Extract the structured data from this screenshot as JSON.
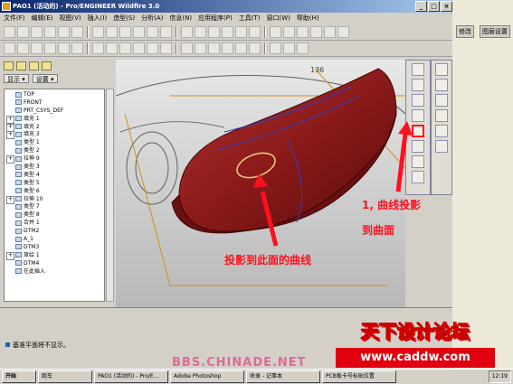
{
  "window": {
    "title": "PAO1 (活动的) - Pro/ENGINEER Wildfire 3.0"
  },
  "menu": [
    "文件(F)",
    "编辑(E)",
    "视图(V)",
    "插入(I)",
    "造型(S)",
    "分析(A)",
    "信息(N)",
    "应用程序(P)",
    "工具(T)",
    "窗口(W)",
    "帮助(H)"
  ],
  "sidepane": {
    "show_label": "显示",
    "settings_label": "设置"
  },
  "model_tree": [
    {
      "label": "TOP",
      "icon": "datum-plane-icon",
      "expand": false
    },
    {
      "label": "FRONT",
      "icon": "datum-plane-icon",
      "expand": false
    },
    {
      "label": "PRT_CSYS_DEF",
      "icon": "csys-icon",
      "expand": false
    },
    {
      "label": "填充 1",
      "icon": "fill-icon",
      "expand": true
    },
    {
      "label": "填充 2",
      "icon": "fill-icon",
      "expand": true
    },
    {
      "label": "填充 3",
      "icon": "fill-icon",
      "expand": true
    },
    {
      "label": "类型 1",
      "icon": "surface-icon",
      "expand": false
    },
    {
      "label": "类型 2",
      "icon": "surface-icon",
      "expand": false
    },
    {
      "label": "拉伸 9",
      "icon": "extrude-icon",
      "expand": true
    },
    {
      "label": "类型 3",
      "icon": "surface-icon",
      "expand": false
    },
    {
      "label": "类型 4",
      "icon": "surface-icon",
      "expand": false
    },
    {
      "label": "类型 5",
      "icon": "surface-icon",
      "expand": false
    },
    {
      "label": "类型 6",
      "icon": "surface-icon",
      "expand": false
    },
    {
      "label": "拉伸 10",
      "icon": "extrude-icon",
      "expand": true
    },
    {
      "label": "类型 7",
      "icon": "surface-icon",
      "expand": false
    },
    {
      "label": "类型 8",
      "icon": "surface-icon",
      "expand": false
    },
    {
      "label": "合并 1",
      "icon": "merge-icon",
      "expand": false
    },
    {
      "label": "DTM2",
      "icon": "datum-plane-icon",
      "expand": false
    },
    {
      "label": "A_1",
      "icon": "axis-icon",
      "expand": false
    },
    {
      "label": "DTM3",
      "icon": "datum-plane-icon",
      "expand": false
    },
    {
      "label": "草绘 1",
      "icon": "sketch-icon",
      "expand": true
    },
    {
      "label": "DTM4",
      "icon": "datum-plane-icon",
      "expand": false
    },
    {
      "label": "在此插入",
      "icon": "insert-here-icon",
      "expand": false
    }
  ],
  "right_tabs": [
    "修改",
    "图层设置"
  ],
  "annotations": {
    "projection_note": "1, 曲线投影",
    "to_surface": "到曲面",
    "project_to_curve": "投影到此面的曲线"
  },
  "message": "基准平面将不显示。",
  "taskbar": {
    "start": "开始",
    "items": [
      "跑车",
      "PAO1 (活动的) - Pro/E...",
      "Adobe Photoshop",
      "收录 - 记事本",
      "PCB板卡号标贴位置"
    ],
    "clock": "12:19"
  },
  "watermark": {
    "title": "天下设计论坛",
    "url": "www.caddw.com",
    "bbs": "BBS.CHINADE.NET"
  },
  "colors": {
    "title_bar": "#0a246a",
    "model_red": "#8b1a1a",
    "annotation": "#ff1020"
  }
}
